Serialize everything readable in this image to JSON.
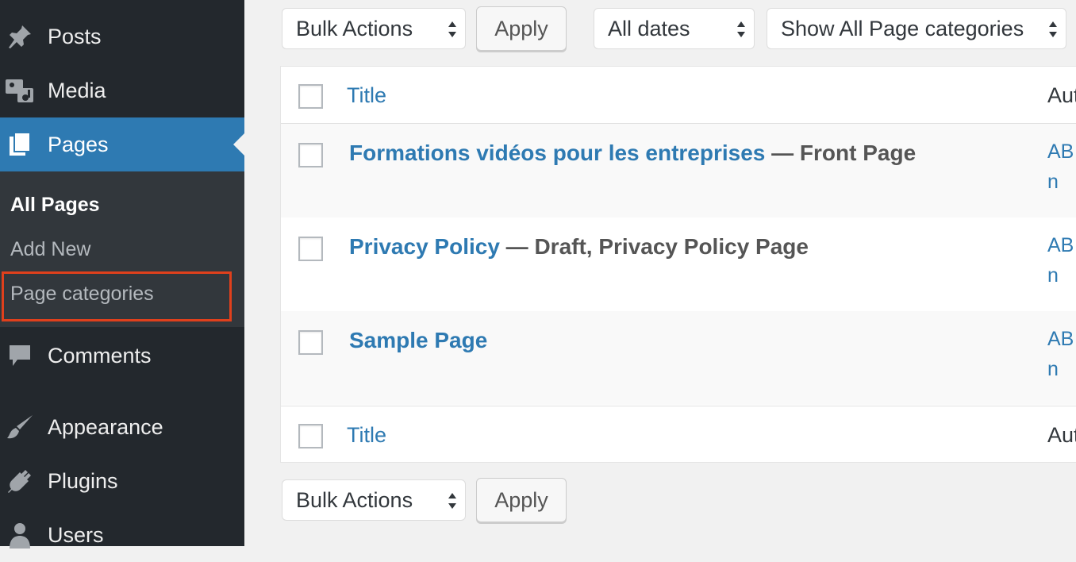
{
  "sidebar": {
    "items": [
      {
        "label": "Posts",
        "icon": "pushpin-icon"
      },
      {
        "label": "Media",
        "icon": "media-icon"
      },
      {
        "label": "Pages",
        "icon": "pages-icon"
      },
      {
        "label": "Comments",
        "icon": "comment-icon"
      },
      {
        "label": "Appearance",
        "icon": "paintbrush-icon"
      },
      {
        "label": "Plugins",
        "icon": "plugin-icon"
      },
      {
        "label": "Users",
        "icon": "users-icon"
      }
    ],
    "submenu": [
      "All Pages",
      "Add New",
      "Page categories"
    ]
  },
  "filters": {
    "bulk_actions": "Bulk Actions",
    "apply": "Apply",
    "dates": "All dates",
    "categories": "Show All Page categories"
  },
  "table": {
    "header_title": "Title",
    "header_author": "Aut",
    "rows": [
      {
        "title": "Formations vidéos pour les entreprises",
        "state": " — Front Page",
        "author": "AB\nn"
      },
      {
        "title": "Privacy Policy",
        "state": " — Draft, Privacy Policy Page",
        "author": "AB\nn"
      },
      {
        "title": "Sample Page",
        "state": "",
        "author": "AB\nn"
      }
    ],
    "footer_title": "Title",
    "footer_author": "Aut"
  },
  "bottom": {
    "bulk_actions": "Bulk Actions",
    "apply": "Apply"
  },
  "colors": {
    "sidebar_bg": "#23282d",
    "submenu_bg": "#32373c",
    "accent": "#2e7ab2",
    "highlight_box": "#e0401c"
  }
}
